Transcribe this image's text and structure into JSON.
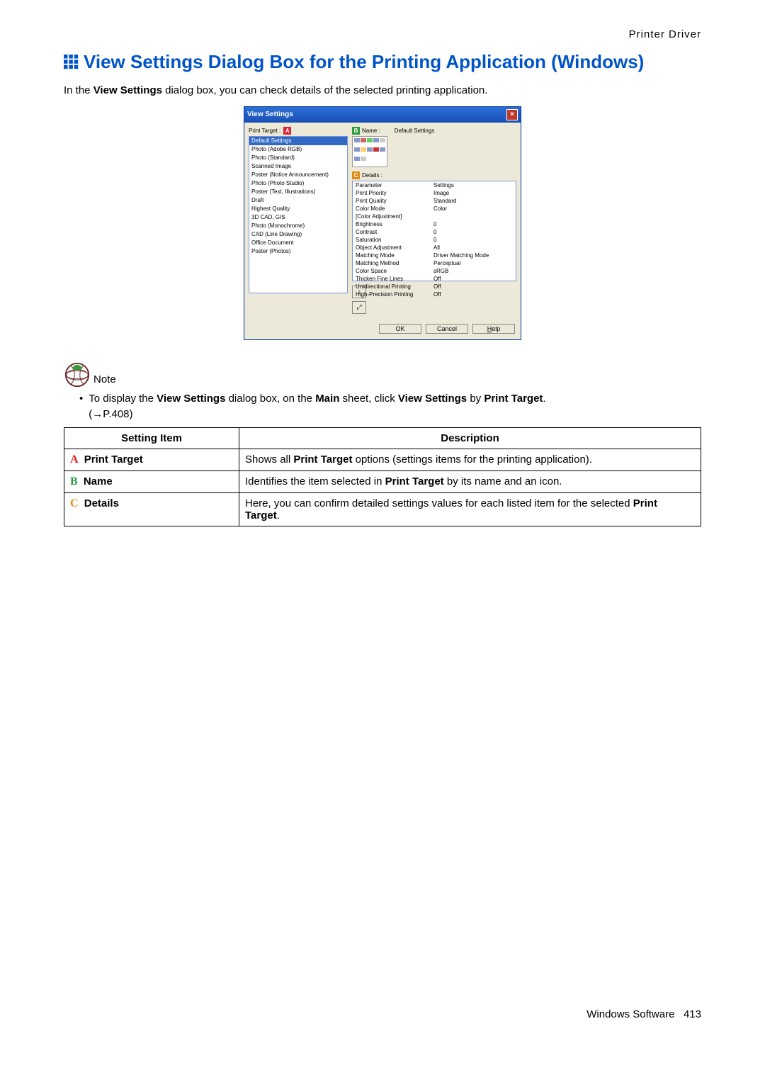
{
  "header": {
    "section": "Printer  Driver"
  },
  "title": "View Settings Dialog Box for the Printing Application (Windows)",
  "intro": {
    "pre": "In the ",
    "bold1": "View Settings",
    "post": " dialog box, you can check details of the selected printing application."
  },
  "dialog": {
    "title": "View Settings",
    "markerA": "A",
    "markerB": "B",
    "markerC": "C",
    "printTargetLabel": "Print Target :",
    "nameLabel": "Name :",
    "nameValue": "Default Settings",
    "detailsLabel": "Details :",
    "list": [
      "Default Settings",
      "Photo (Adobe RGB)",
      "Photo (Standard)",
      "Scanned Image",
      "Poster (Notice Announcement)",
      "Photo (Photo Studio)",
      "Poster (Text, Illustrations)",
      "Draft",
      "Highest Quality",
      "3D CAD, GIS",
      "Photo (Monochrome)",
      "CAD (Line Drawing)",
      "Office Document",
      "Poster (Photos)"
    ],
    "detailsHead": {
      "c1": "Parameter",
      "c2": "Settings"
    },
    "detailsRows": [
      {
        "c1": "Print Priority",
        "c2": "Image"
      },
      {
        "c1": "Print Quality",
        "c2": "Standard"
      },
      {
        "c1": "Color Mode",
        "c2": "Color"
      },
      {
        "c1": "[Color Adjustment]",
        "c2": ""
      },
      {
        "c1": "  Brightness",
        "c2": "0"
      },
      {
        "c1": "  Contrast",
        "c2": "0"
      },
      {
        "c1": "  Saturation",
        "c2": "0"
      },
      {
        "c1": "  Object Adjustment",
        "c2": "All"
      },
      {
        "c1": "  Matching Mode",
        "c2": "Driver Matching Mode"
      },
      {
        "c1": "  Matching Method",
        "c2": "Perceptual"
      },
      {
        "c1": "  Color Space",
        "c2": "sRGB"
      },
      {
        "c1": "Thicken Fine Lines",
        "c2": "Off"
      },
      {
        "c1": "Unidirectional Printing",
        "c2": "Off"
      },
      {
        "c1": "High-Precision Printing",
        "c2": "Off"
      }
    ],
    "buttons": {
      "ok": "OK",
      "cancel": "Cancel",
      "help": "Help"
    }
  },
  "note": {
    "label": "Note",
    "bullet_pre": "To display the ",
    "bullet_b1": "View Settings",
    "bullet_mid1": " dialog box, on the ",
    "bullet_b2": "Main",
    "bullet_mid2": " sheet, click ",
    "bullet_b3": "View Settings",
    "bullet_mid3": " by ",
    "bullet_b4": "Print Target",
    "bullet_post": ".",
    "ref": "(→P.408)"
  },
  "table": {
    "head": {
      "c1": "Setting Item",
      "c2": "Description"
    },
    "rows": [
      {
        "marker": "A",
        "markerClass": "rm-red",
        "name": "Print Target",
        "desc_pre": "Shows all ",
        "desc_b": "Print Target",
        "desc_post": " options (settings items for the printing application)."
      },
      {
        "marker": "B",
        "markerClass": "rm-green",
        "name": "Name",
        "desc_pre": "Identifies the item selected in ",
        "desc_b": "Print Target",
        "desc_post": " by its name and an icon."
      },
      {
        "marker": "C",
        "markerClass": "rm-orange",
        "name": "Details",
        "desc_pre": "Here, you can confirm detailed settings values for each listed item for the selected ",
        "desc_b": "Print Target",
        "desc_post": "."
      }
    ]
  },
  "footer": {
    "left": "Windows  Software",
    "page": "413"
  }
}
